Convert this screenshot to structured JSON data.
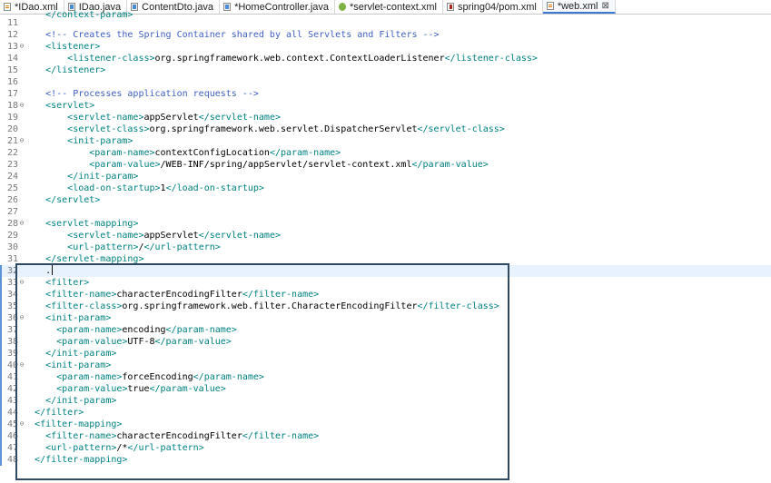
{
  "tabs": [
    {
      "label": "*IDao.xml",
      "icon": "xml-file-icon",
      "active": false
    },
    {
      "label": "IDao.java",
      "icon": "java-file-icon",
      "active": false
    },
    {
      "label": "ContentDto.java",
      "icon": "java-file-icon",
      "active": false
    },
    {
      "label": "*HomeController.java",
      "icon": "java-file-icon",
      "active": false
    },
    {
      "label": "*servlet-context.xml",
      "icon": "spring-config-icon",
      "active": false
    },
    {
      "label": "spring04/pom.xml",
      "icon": "maven-pom-icon",
      "active": false
    },
    {
      "label": "*web.xml",
      "icon": "xml-file-icon",
      "active": true
    }
  ],
  "close_glyph": "⊠",
  "partial_top_line": "    </context-param>",
  "current_line": 32,
  "fold_lines": [
    13,
    18,
    21,
    28,
    33,
    36,
    40,
    45
  ],
  "lines": [
    {
      "n": "11",
      "segs": [
        {
          "t": "",
          "c": "text"
        }
      ]
    },
    {
      "n": "12",
      "segs": [
        {
          "t": "    ",
          "c": "text"
        },
        {
          "t": "<!-- Creates the Spring Container shared by all Servlets and Filters -->",
          "c": "comment"
        }
      ]
    },
    {
      "n": "13",
      "segs": [
        {
          "t": "    ",
          "c": "text"
        },
        {
          "t": "<listener>",
          "c": "tag"
        }
      ]
    },
    {
      "n": "14",
      "segs": [
        {
          "t": "        ",
          "c": "text"
        },
        {
          "t": "<listener-class>",
          "c": "tag"
        },
        {
          "t": "org.springframework.web.context.ContextLoaderListener",
          "c": "text"
        },
        {
          "t": "</listener-class>",
          "c": "tag"
        }
      ]
    },
    {
      "n": "15",
      "segs": [
        {
          "t": "    ",
          "c": "text"
        },
        {
          "t": "</listener>",
          "c": "tag"
        }
      ]
    },
    {
      "n": "16",
      "segs": [
        {
          "t": "",
          "c": "text"
        }
      ]
    },
    {
      "n": "17",
      "segs": [
        {
          "t": "    ",
          "c": "text"
        },
        {
          "t": "<!-- Processes application requests -->",
          "c": "comment"
        }
      ]
    },
    {
      "n": "18",
      "segs": [
        {
          "t": "    ",
          "c": "text"
        },
        {
          "t": "<servlet>",
          "c": "tag"
        }
      ]
    },
    {
      "n": "19",
      "segs": [
        {
          "t": "        ",
          "c": "text"
        },
        {
          "t": "<servlet-name>",
          "c": "tag"
        },
        {
          "t": "appServlet",
          "c": "text"
        },
        {
          "t": "</servlet-name>",
          "c": "tag"
        }
      ]
    },
    {
      "n": "20",
      "segs": [
        {
          "t": "        ",
          "c": "text"
        },
        {
          "t": "<servlet-class>",
          "c": "tag"
        },
        {
          "t": "org.springframework.web.servlet.DispatcherServlet",
          "c": "text"
        },
        {
          "t": "</servlet-class>",
          "c": "tag"
        }
      ]
    },
    {
      "n": "21",
      "segs": [
        {
          "t": "        ",
          "c": "text"
        },
        {
          "t": "<init-param>",
          "c": "tag"
        }
      ]
    },
    {
      "n": "22",
      "segs": [
        {
          "t": "            ",
          "c": "text"
        },
        {
          "t": "<param-name>",
          "c": "tag"
        },
        {
          "t": "contextConfigLocation",
          "c": "text"
        },
        {
          "t": "</param-name>",
          "c": "tag"
        }
      ]
    },
    {
      "n": "23",
      "segs": [
        {
          "t": "            ",
          "c": "text"
        },
        {
          "t": "<param-value>",
          "c": "tag"
        },
        {
          "t": "/WEB-INF/spring/appServlet/servlet-context.xml",
          "c": "text"
        },
        {
          "t": "</param-value>",
          "c": "tag"
        }
      ]
    },
    {
      "n": "24",
      "segs": [
        {
          "t": "        ",
          "c": "text"
        },
        {
          "t": "</init-param>",
          "c": "tag"
        }
      ]
    },
    {
      "n": "25",
      "segs": [
        {
          "t": "        ",
          "c": "text"
        },
        {
          "t": "<load-on-startup>",
          "c": "tag"
        },
        {
          "t": "1",
          "c": "text"
        },
        {
          "t": "</load-on-startup>",
          "c": "tag"
        }
      ]
    },
    {
      "n": "26",
      "segs": [
        {
          "t": "    ",
          "c": "text"
        },
        {
          "t": "</servlet>",
          "c": "tag"
        }
      ]
    },
    {
      "n": "27",
      "segs": [
        {
          "t": "",
          "c": "text"
        }
      ]
    },
    {
      "n": "28",
      "segs": [
        {
          "t": "    ",
          "c": "text"
        },
        {
          "t": "<servlet-mapping>",
          "c": "tag"
        }
      ]
    },
    {
      "n": "29",
      "segs": [
        {
          "t": "        ",
          "c": "text"
        },
        {
          "t": "<servlet-name>",
          "c": "tag"
        },
        {
          "t": "appServlet",
          "c": "text"
        },
        {
          "t": "</servlet-name>",
          "c": "tag"
        }
      ]
    },
    {
      "n": "30",
      "segs": [
        {
          "t": "        ",
          "c": "text"
        },
        {
          "t": "<url-pattern>",
          "c": "tag"
        },
        {
          "t": "/",
          "c": "text"
        },
        {
          "t": "</url-pattern>",
          "c": "tag"
        }
      ]
    },
    {
      "n": "31",
      "segs": [
        {
          "t": "    ",
          "c": "text"
        },
        {
          "t": "</servlet-mapping>",
          "c": "tag"
        }
      ]
    },
    {
      "n": "32",
      "segs": [
        {
          "t": "    ",
          "c": "text"
        },
        {
          "t": ".",
          "c": "text"
        }
      ]
    },
    {
      "n": "33",
      "segs": [
        {
          "t": "    ",
          "c": "text"
        },
        {
          "t": "<filter>",
          "c": "tag"
        }
      ]
    },
    {
      "n": "34",
      "segs": [
        {
          "t": "    ",
          "c": "text"
        },
        {
          "t": "<filter-name>",
          "c": "tag"
        },
        {
          "t": "characterEncodingFilter",
          "c": "text"
        },
        {
          "t": "</filter-name>",
          "c": "tag"
        }
      ]
    },
    {
      "n": "35",
      "segs": [
        {
          "t": "    ",
          "c": "text"
        },
        {
          "t": "<filter-class>",
          "c": "tag"
        },
        {
          "t": "org.springframework.web.filter.CharacterEncodingFilter",
          "c": "text"
        },
        {
          "t": "</filter-class>",
          "c": "tag"
        }
      ]
    },
    {
      "n": "36",
      "segs": [
        {
          "t": "    ",
          "c": "text"
        },
        {
          "t": "<init-param>",
          "c": "tag"
        }
      ]
    },
    {
      "n": "37",
      "segs": [
        {
          "t": "      ",
          "c": "text"
        },
        {
          "t": "<param-name>",
          "c": "tag"
        },
        {
          "t": "encoding",
          "c": "text"
        },
        {
          "t": "</param-name>",
          "c": "tag"
        }
      ]
    },
    {
      "n": "38",
      "segs": [
        {
          "t": "      ",
          "c": "text"
        },
        {
          "t": "<param-value>",
          "c": "tag"
        },
        {
          "t": "UTF-8",
          "c": "text"
        },
        {
          "t": "</param-value>",
          "c": "tag"
        }
      ]
    },
    {
      "n": "39",
      "segs": [
        {
          "t": "    ",
          "c": "text"
        },
        {
          "t": "</init-param>",
          "c": "tag"
        }
      ]
    },
    {
      "n": "40",
      "segs": [
        {
          "t": "    ",
          "c": "text"
        },
        {
          "t": "<init-param>",
          "c": "tag"
        }
      ]
    },
    {
      "n": "41",
      "segs": [
        {
          "t": "      ",
          "c": "text"
        },
        {
          "t": "<param-name>",
          "c": "tag"
        },
        {
          "t": "forceEncoding",
          "c": "text"
        },
        {
          "t": "</param-name>",
          "c": "tag"
        }
      ]
    },
    {
      "n": "42",
      "segs": [
        {
          "t": "      ",
          "c": "text"
        },
        {
          "t": "<param-value>",
          "c": "tag"
        },
        {
          "t": "true",
          "c": "text"
        },
        {
          "t": "</param-value>",
          "c": "tag"
        }
      ]
    },
    {
      "n": "43",
      "segs": [
        {
          "t": "    ",
          "c": "text"
        },
        {
          "t": "</init-param>",
          "c": "tag"
        }
      ]
    },
    {
      "n": "44",
      "segs": [
        {
          "t": "  ",
          "c": "text"
        },
        {
          "t": "</filter>",
          "c": "tag"
        }
      ]
    },
    {
      "n": "45",
      "segs": [
        {
          "t": "  ",
          "c": "text"
        },
        {
          "t": "<filter-mapping>",
          "c": "tag"
        }
      ]
    },
    {
      "n": "46",
      "segs": [
        {
          "t": "    ",
          "c": "text"
        },
        {
          "t": "<filter-name>",
          "c": "tag"
        },
        {
          "t": "characterEncodingFilter",
          "c": "text"
        },
        {
          "t": "</filter-name>",
          "c": "tag"
        }
      ]
    },
    {
      "n": "47",
      "segs": [
        {
          "t": "    ",
          "c": "text"
        },
        {
          "t": "<url-pattern>",
          "c": "tag"
        },
        {
          "t": "/*",
          "c": "text"
        },
        {
          "t": "</url-pattern>",
          "c": "tag"
        }
      ]
    },
    {
      "n": "48",
      "segs": [
        {
          "t": "  ",
          "c": "text"
        },
        {
          "t": "</filter-mapping>",
          "c": "tag"
        }
      ]
    }
  ],
  "colors": {
    "comment": "#3f5fbf",
    "tag": "#008080",
    "text": "#000000",
    "current_line": "#e8f2fe",
    "annotation_box": "#2f4863"
  }
}
